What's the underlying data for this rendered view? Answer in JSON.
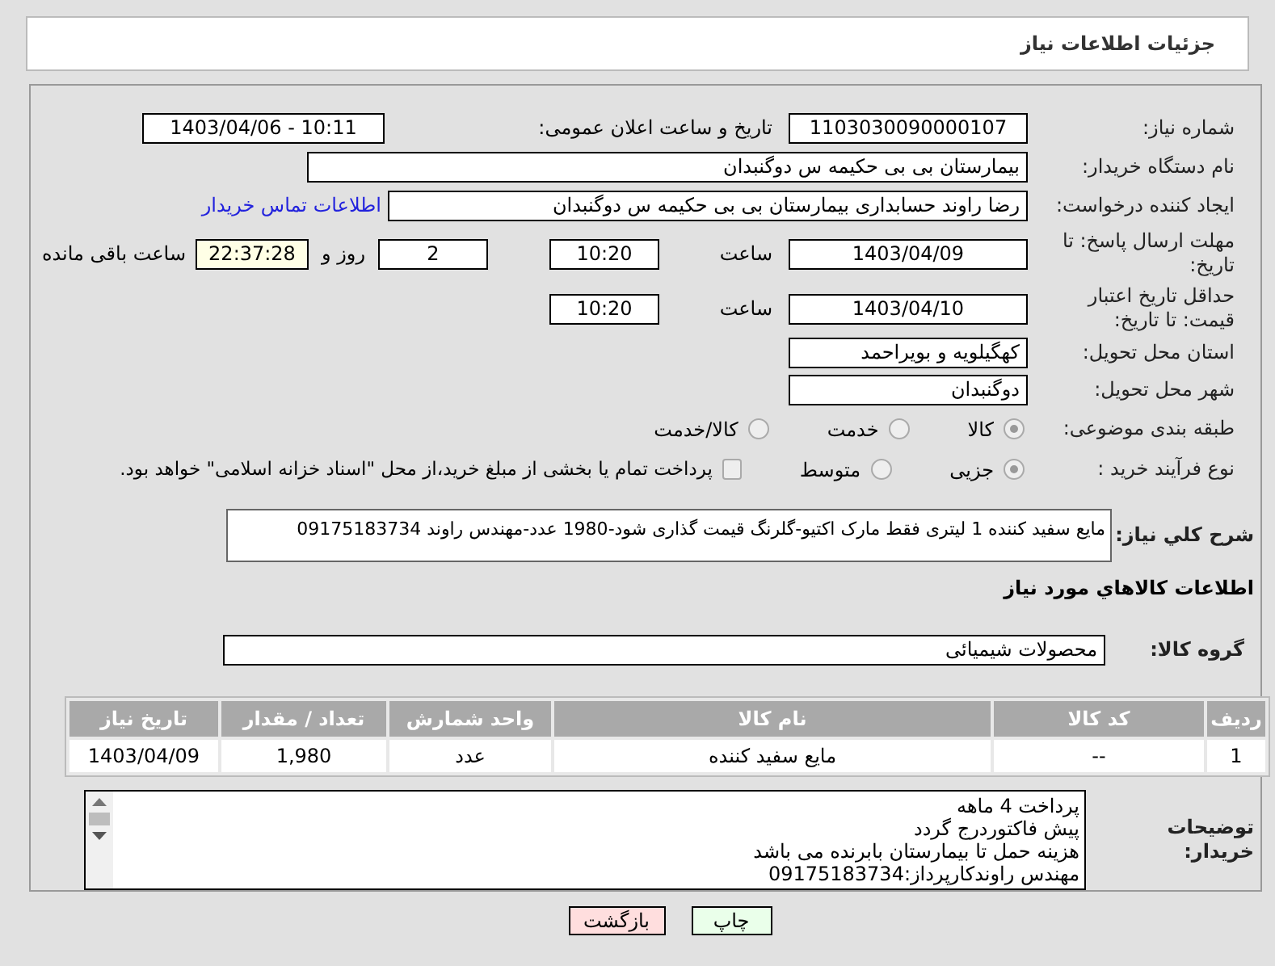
{
  "header": {
    "title": "جزئیات اطلاعات نیاز"
  },
  "need_number": {
    "label": "شماره نیاز:",
    "value": "1103030090000107"
  },
  "announce": {
    "label": "تاریخ و ساعت اعلان عمومی:",
    "value": "1403/04/06 - 10:11"
  },
  "buyer_org": {
    "label": "نام دستگاه خریدار:",
    "value": "بیمارستان بی بی حکیمه س  دوگنبدان"
  },
  "requester": {
    "label": "ایجاد کننده درخواست:",
    "value": "رضا راوند حسابداری بیمارستان بی بی حکیمه س  دوگنبدان",
    "link": "اطلاعات تماس خریدار"
  },
  "reply_deadline": {
    "label": "مهلت ارسال پاسخ: تا تاریخ:",
    "date": "1403/04/09",
    "time_label": "ساعت",
    "time": "10:20",
    "days": "2",
    "days_label": "روز و",
    "remaining": "22:37:28",
    "remaining_label": "ساعت باقی مانده"
  },
  "price_validity": {
    "label": "حداقل تاریخ اعتبار قیمت: تا تاریخ:",
    "date": "1403/04/10",
    "time_label": "ساعت",
    "time": "10:20"
  },
  "province": {
    "label": "استان محل تحویل:",
    "value": "کهگیلویه و بویراحمد"
  },
  "city": {
    "label": "شهر محل تحویل:",
    "value": "دوگنبدان"
  },
  "category": {
    "label": "طبقه بندی موضوعی:",
    "options": [
      {
        "label": "کالا",
        "selected": true
      },
      {
        "label": "خدمت",
        "selected": false
      },
      {
        "label": "کالا/خدمت",
        "selected": false
      }
    ]
  },
  "purchase_type": {
    "label": "نوع فرآیند خرید :",
    "options": [
      {
        "label": "جزیی",
        "selected": true
      },
      {
        "label": "متوسط",
        "selected": false
      }
    ],
    "checkbox": {
      "label": "پرداخت تمام یا بخشی از مبلغ خرید،از محل \"اسناد خزانه اسلامی\" خواهد بود.",
      "checked": false
    }
  },
  "description": {
    "label": "شرح كلي نياز:",
    "value": "مایع سفید کننده 1 لیتری فقط مارک اکتیو-گلرنگ قیمت گذاری شود-1980 عدد-مهندس راوند 09175183734"
  },
  "goods_title": "اطلاعات كالاهاي مورد نياز",
  "goods_group": {
    "label": "گروه کالا:",
    "value": "محصولات شیمیائی"
  },
  "table": {
    "columns": [
      "ردیف",
      "کد کالا",
      "نام کالا",
      "واحد شمارش",
      "تعداد / مقدار",
      "تاریخ نیاز"
    ],
    "rows": [
      [
        "1",
        "--",
        "مایع سفید کننده",
        "عدد",
        "1,980",
        "1403/04/09"
      ]
    ]
  },
  "buyer_notes": {
    "label": "توضیحات خریدار:",
    "lines": [
      "پرداخت 4 ماهه",
      "پیش فاکتوردرج گردد",
      "هزینه حمل تا بیمارستان بابرنده می باشد",
      "مهندس راوندکارپرداز:09175183734"
    ]
  },
  "buttons": [
    {
      "label": "چاپ",
      "kind": "print"
    },
    {
      "label": "بازگشت",
      "kind": "back"
    }
  ]
}
